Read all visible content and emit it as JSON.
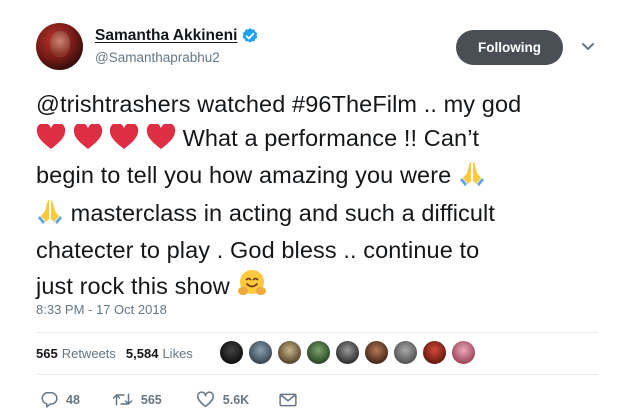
{
  "author": {
    "display_name": "Samantha Akkineni",
    "handle": "@Samanthaprabhu2",
    "verified": true
  },
  "follow_button": {
    "label": "Following"
  },
  "tweet": {
    "lines": [
      "@trishtrashers watched #96TheFilm .. my god",
      "What a performance !! Can’t",
      "begin to tell you how amazing you were",
      "masterclass in acting and such a difficult",
      "chatecter to play . God bless .. continue to",
      "just rock this show"
    ],
    "emojis": [
      "red-heart",
      "folded-hands",
      "hugging-face"
    ]
  },
  "timestamp": "8:33 PM - 17 Oct 2018",
  "stats": {
    "retweets_count": "565",
    "retweets_label": "Retweets",
    "likes_count": "5,584",
    "likes_label": "Likes"
  },
  "likers_avatars_count": 9,
  "actions": {
    "reply_count": "48",
    "retweet_count": "565",
    "like_count": "5.6K"
  },
  "colors": {
    "text": "#14171a",
    "secondary": "#657786",
    "verified": "#1da1f2",
    "following_btn": "#4a4f55",
    "heart": "#dd2e44"
  }
}
